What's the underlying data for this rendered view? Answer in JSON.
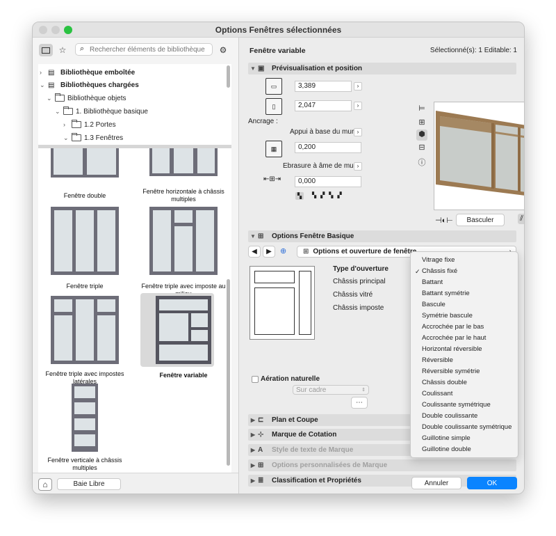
{
  "window": {
    "title": "Options Fenêtres sélectionnées"
  },
  "left": {
    "search_placeholder": "Rechercher éléments de bibliothèque",
    "tree": [
      {
        "label": "Bibliothèque emboîtée",
        "bold": true
      },
      {
        "label": "Bibliothèques chargées",
        "bold": true
      },
      {
        "label": "Bibliothèque objets",
        "bold": false
      },
      {
        "label": "1. Bibliothèque basique",
        "bold": false
      },
      {
        "label": "1.2 Portes",
        "bold": false
      },
      {
        "label": "1.3 Fenêtres",
        "bold": false
      }
    ],
    "tiles": [
      "Fenêtre double",
      "Fenêtre horizontale à châssis multiples",
      "Fenêtre triple",
      "Fenêtre triple avec imposte au milieu",
      "Fenêtre triple avec impostes latérales",
      "Fenêtre variable",
      "Fenêtre verticale à châssis multiples"
    ],
    "bottom_button": "Baie Libre"
  },
  "right": {
    "object_name": "Fenêtre variable",
    "selection_info": "Sélectionné(s): 1 Editable: 1",
    "sections": {
      "preview": "Prévisualisation et position",
      "basic": "Options Fenêtre Basique",
      "plan": "Plan et Coupe",
      "dim": "Marque de Cotation",
      "style": "Style de texte de Marque",
      "custom": "Options personnalisées de Marque",
      "classif": "Classification et Propriétés"
    },
    "width_value": "3,389",
    "height_value": "2,047",
    "anchor_label": "Ancrage :",
    "anchor_dropdown": "Appui à base du mur",
    "anchor_value": "0,200",
    "reveal_dropdown": "Ebrasure à âme de mur",
    "reveal_value": "0,000",
    "flip_button": "Basculer",
    "page_selector": "Options et ouverture de fenêtre...",
    "opening_title": "Type d'ouverture",
    "opening_rows": [
      "Châssis principal",
      "Châssis vitré",
      "Châssis imposte"
    ],
    "ventilation_label": "Aération naturelle",
    "ventilation_value": "Sur cadre",
    "cancel": "Annuler",
    "ok": "OK"
  },
  "menu": {
    "items": [
      "Vitrage fixe",
      "Châssis fixé",
      "Battant",
      "Battant symétrie",
      "Bascule",
      "Symétrie bascule",
      "Accrochée par le bas",
      "Accrochée par le haut",
      "Horizontal réversible",
      "Réversible",
      "Réversible symétrie",
      "Châssis double",
      "Coulissant",
      "Coulissante symétrique",
      "Double coulissante",
      "Double coulissante symétrique",
      "Guillotine simple",
      "Guillotine double"
    ],
    "checked": "Châssis fixé"
  }
}
